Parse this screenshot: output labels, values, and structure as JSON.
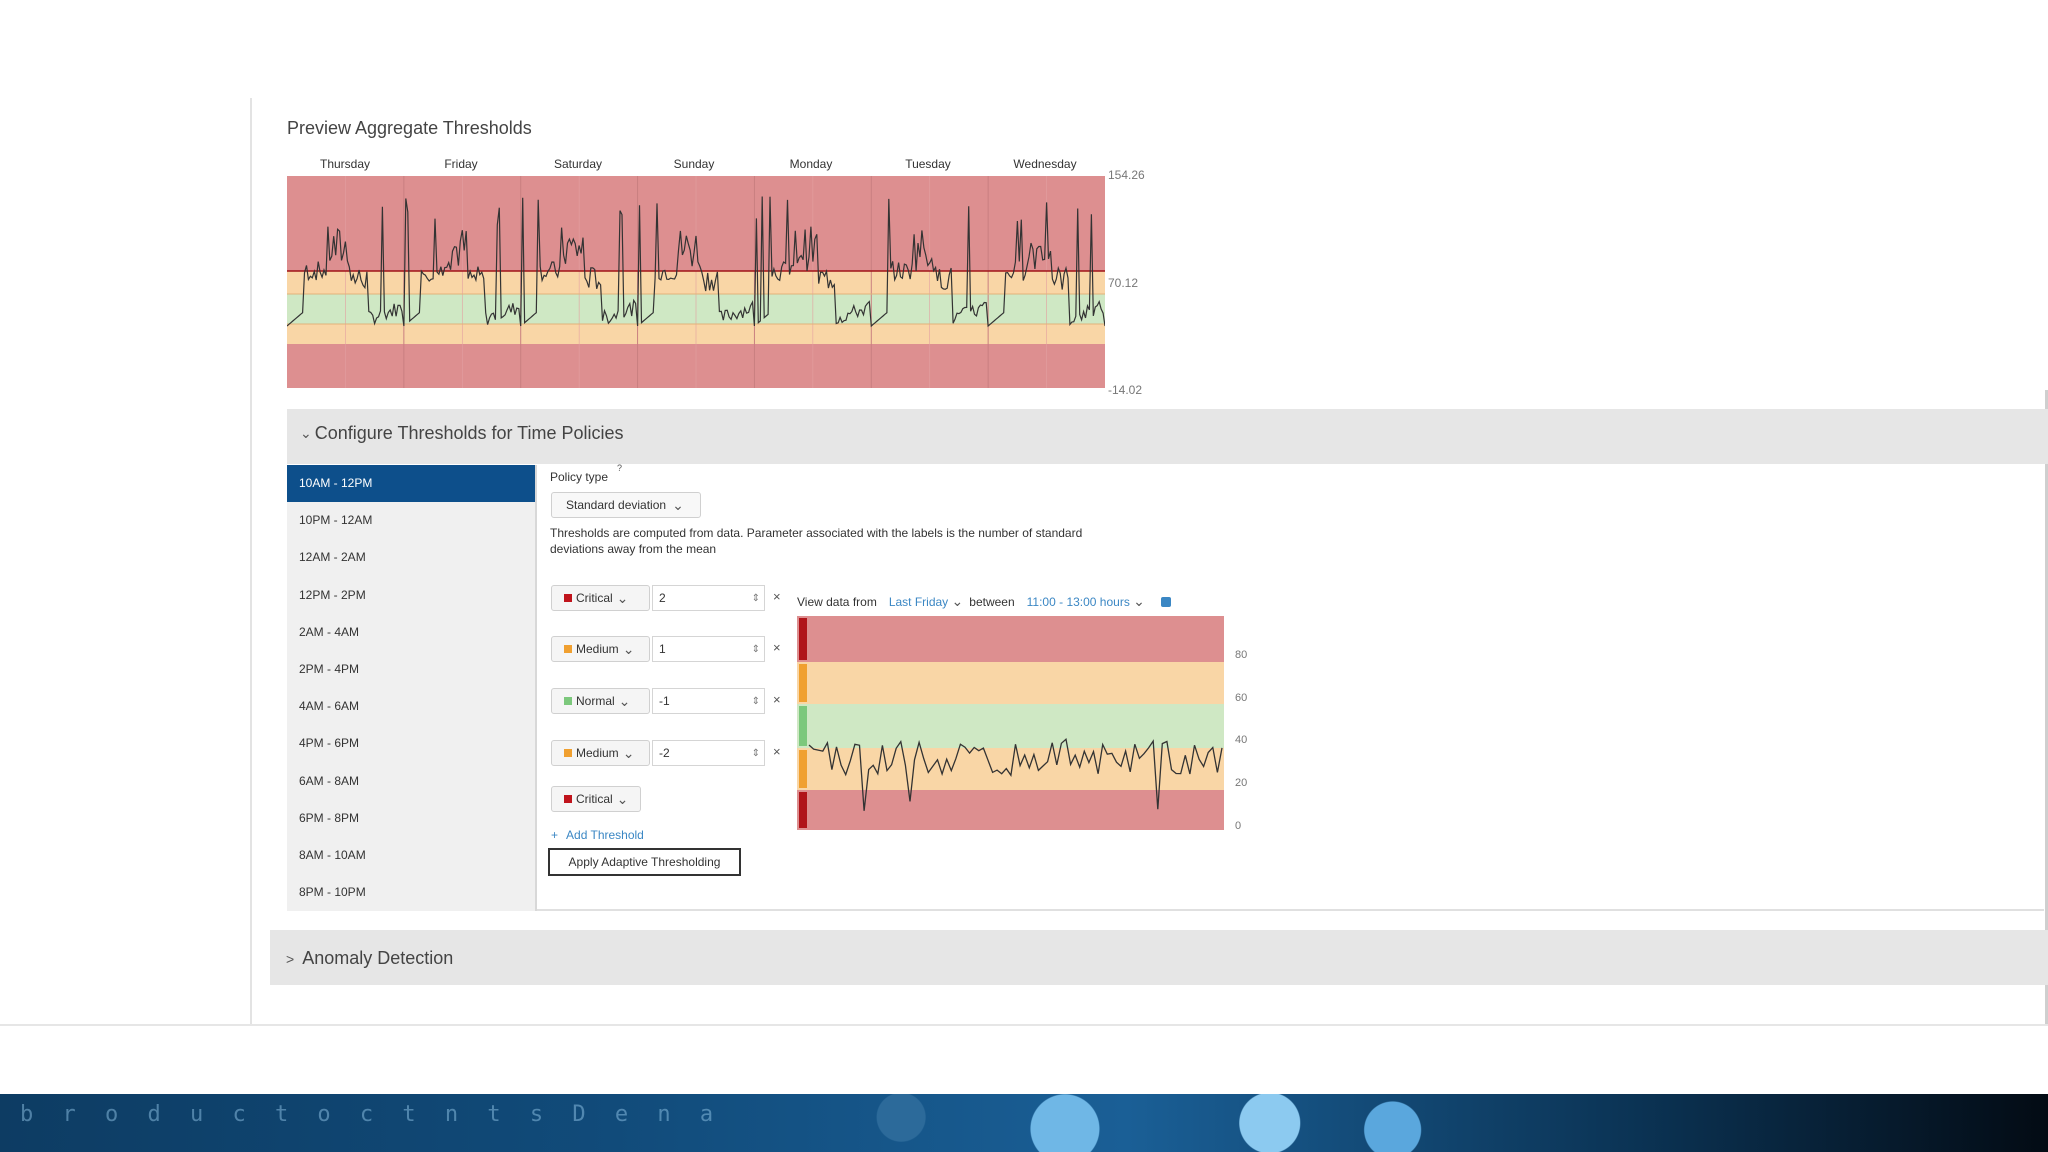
{
  "preview": {
    "title": "Preview Aggregate Thresholds",
    "days": [
      "Thursday",
      "Friday",
      "Saturday",
      "Sunday",
      "Monday",
      "Tuesday",
      "Wednesday"
    ],
    "axis": {
      "max": "154.26",
      "mid": "70.12",
      "min": "-14.02"
    }
  },
  "configure": {
    "title": "Configure Thresholds for Time Policies",
    "time_policies": [
      "10AM - 12PM",
      "10PM - 12AM",
      "12AM - 2AM",
      "12PM - 2PM",
      "2AM - 4AM",
      "2PM - 4PM",
      "4AM - 6AM",
      "4PM - 6PM",
      "6AM - 8AM",
      "6PM - 8PM",
      "8AM - 10AM",
      "8PM - 10PM"
    ],
    "selected_policy": "10AM - 12PM",
    "policy_type_label": "Policy type",
    "policy_type_superscript": "?",
    "policy_type_value": "Standard deviation",
    "help_text": "Thresholds are computed from data. Parameter associated with the labels is the number of standard deviations away from the mean",
    "thresholds": [
      {
        "severity": "Critical",
        "value": "2",
        "color": "#c0141c"
      },
      {
        "severity": "Medium",
        "value": "1",
        "color": "#f0a030"
      },
      {
        "severity": "Normal",
        "value": "-1",
        "color": "#7cc87c"
      },
      {
        "severity": "Medium",
        "value": "-2",
        "color": "#f0a030"
      }
    ],
    "last_severity": {
      "severity": "Critical",
      "color": "#c0141c"
    },
    "add_threshold": "Add Threshold",
    "apply_button": "Apply Adaptive Thresholding",
    "view_data": {
      "prefix": "View data from",
      "range": "Last Friday",
      "between": "between",
      "hours": "11:00 - 13:00 hours"
    },
    "detail_axis": [
      "80",
      "60",
      "40",
      "20",
      "0"
    ]
  },
  "anomaly": {
    "title": "Anomaly Detection"
  },
  "colors": {
    "critical_band": "#dd8f90",
    "medium_band": "#f9d6a6",
    "normal_band": "#cfe8c4",
    "selected_policy_bg": "#0d4f8b",
    "link": "#3b87c4"
  },
  "banner_text": "b r o d u c t   o c t   n   t s   D e n a"
}
